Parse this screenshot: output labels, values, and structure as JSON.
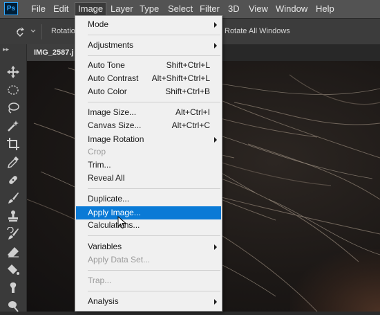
{
  "menubar": {
    "logo": "Ps",
    "items": [
      "File",
      "Edit",
      "Image",
      "Layer",
      "Type",
      "Select",
      "Filter",
      "3D",
      "View",
      "Window",
      "Help"
    ],
    "active": "Image"
  },
  "options_bar": {
    "rotation_label": "Rotation",
    "rotate_all_label": "Rotate All Windows"
  },
  "document": {
    "tab_title": "IMG_2587.j"
  },
  "image_menu": {
    "mode": {
      "label": "Mode"
    },
    "adjustments": {
      "label": "Adjustments"
    },
    "auto_tone": {
      "label": "Auto Tone",
      "shortcut": "Shift+Ctrl+L"
    },
    "auto_contrast": {
      "label": "Auto Contrast",
      "shortcut": "Alt+Shift+Ctrl+L"
    },
    "auto_color": {
      "label": "Auto Color",
      "shortcut": "Shift+Ctrl+B"
    },
    "image_size": {
      "label": "Image Size...",
      "shortcut": "Alt+Ctrl+I"
    },
    "canvas_size": {
      "label": "Canvas Size...",
      "shortcut": "Alt+Ctrl+C"
    },
    "image_rotation": {
      "label": "Image Rotation"
    },
    "crop": {
      "label": "Crop"
    },
    "trim": {
      "label": "Trim..."
    },
    "reveal_all": {
      "label": "Reveal All"
    },
    "duplicate": {
      "label": "Duplicate..."
    },
    "apply_image": {
      "label": "Apply Image..."
    },
    "calculations": {
      "label": "Calculations..."
    },
    "variables": {
      "label": "Variables"
    },
    "apply_data_set": {
      "label": "Apply Data Set..."
    },
    "trap": {
      "label": "Trap..."
    },
    "analysis": {
      "label": "Analysis"
    }
  },
  "colors": {
    "menubar_bg": "#535353",
    "highlight": "#0a7ad6",
    "menu_bg": "#f0f0f0",
    "disabled_text": "#9a9a9a"
  }
}
